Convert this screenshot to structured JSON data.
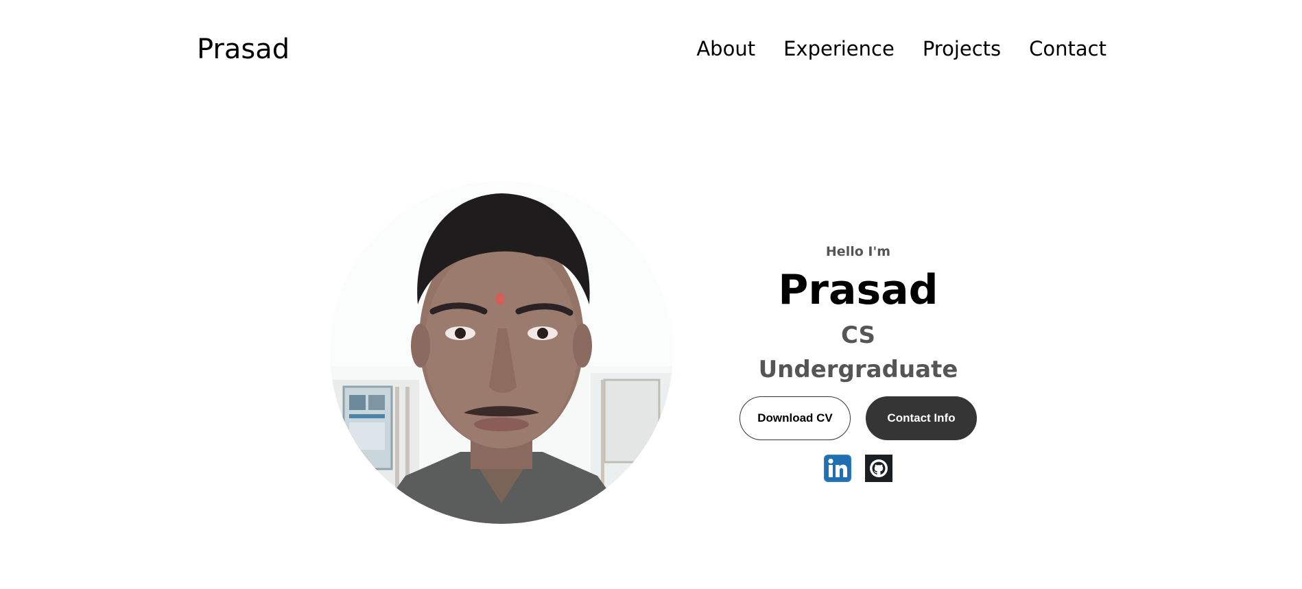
{
  "nav": {
    "logo": "Prasad",
    "links": [
      {
        "label": "About"
      },
      {
        "label": "Experience"
      },
      {
        "label": "Projects"
      },
      {
        "label": "Contact"
      }
    ]
  },
  "hero": {
    "greeting": "Hello I'm",
    "name": "Prasad",
    "role": "CS Undergraduate",
    "buttons": {
      "download_cv": "Download CV",
      "contact_info": "Contact Info"
    },
    "profile_pic_alt": "Profile picture",
    "socials": [
      {
        "icon": "linkedin-icon",
        "alt": "My LinkedIn profile"
      },
      {
        "icon": "github-icon",
        "alt": "My Github profile"
      }
    ]
  },
  "colors": {
    "text": "#000000",
    "muted": "#555555",
    "button_dark": "#353535",
    "linkedin": "#1c75b8",
    "github_bg": "#1b1f23"
  }
}
